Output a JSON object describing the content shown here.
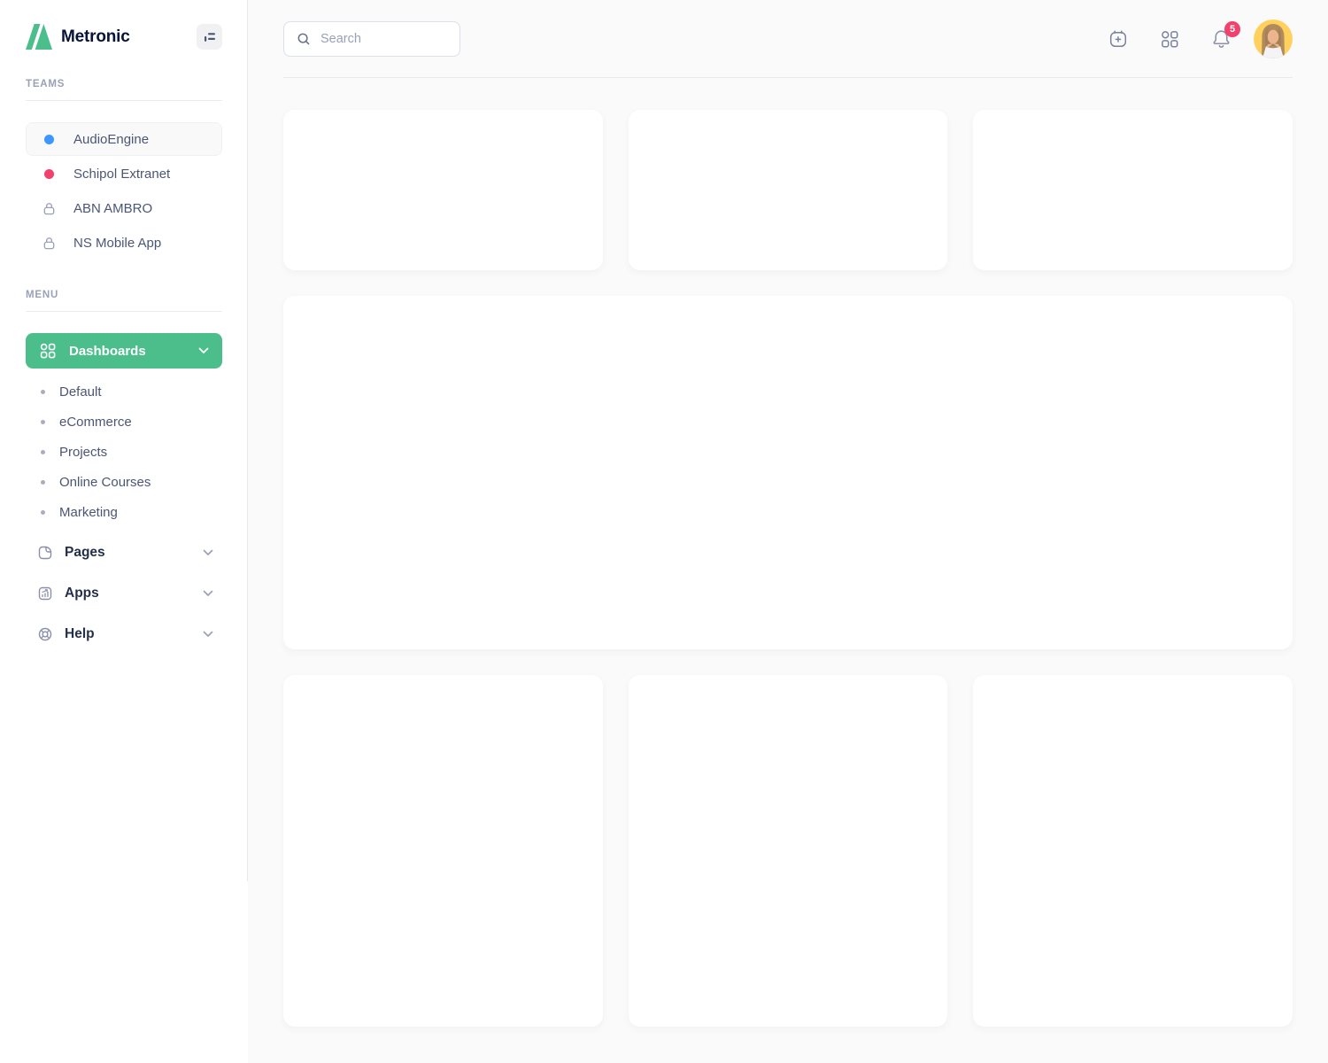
{
  "sidebar": {
    "logo_text": "Metronic",
    "teams_label": "TEAMS",
    "teams": [
      {
        "label": "AudioEngine"
      },
      {
        "label": "Schipol Extranet"
      },
      {
        "label": "ABN AMBRO"
      },
      {
        "label": "NS Mobile App"
      }
    ],
    "menu_label": "MENU",
    "dashboards_label": "Dashboards",
    "dashboard_items": [
      "Default",
      "eCommerce",
      "Projects",
      "Online Courses",
      "Marketing"
    ],
    "pages_label": "Pages",
    "apps_label": "Apps",
    "help_label": "Help"
  },
  "header": {
    "search_placeholder": "Search",
    "notification_count": "5"
  },
  "colors": {
    "accent_green": "#4BBE8B",
    "team_dot_blue": "#3E97FF",
    "team_dot_red": "#F1416C",
    "notification_badge": "#F1416C",
    "logo_text": "#071437",
    "sidebar_bg": "#FFFFFF",
    "content_bg": "#FAFAFA"
  }
}
